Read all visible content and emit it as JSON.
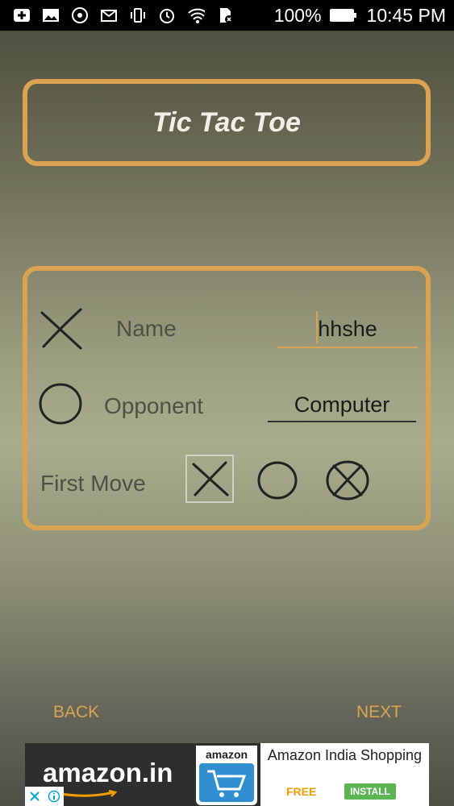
{
  "status_bar": {
    "battery": "100%",
    "time": "10:45 PM",
    "icons": [
      "add-icon",
      "image-icon",
      "music-icon",
      "mail-icon",
      "vibrate-icon",
      "alarm-icon",
      "wifi-icon",
      "sd-card-icon",
      "battery-icon"
    ]
  },
  "header": {
    "title": "Tic Tac Toe"
  },
  "form": {
    "name_label": "Name",
    "name_value": "hhshe",
    "opponent_label": "Opponent",
    "opponent_value": "Computer",
    "first_move_label": "First Move",
    "first_move_options": [
      "x-icon",
      "o-icon",
      "random-icon"
    ],
    "first_move_selected": "x-icon"
  },
  "nav": {
    "back_label": "BACK",
    "next_label": "NEXT"
  },
  "ad": {
    "logo": "amazon.in",
    "app_icon_text": "amazon",
    "title": "Amazon India Shopping",
    "price": "FREE",
    "install_label": "INSTALL"
  },
  "colors": {
    "accent": "#d9a352",
    "status_bar": "#000000",
    "install_green": "#5ab552"
  }
}
